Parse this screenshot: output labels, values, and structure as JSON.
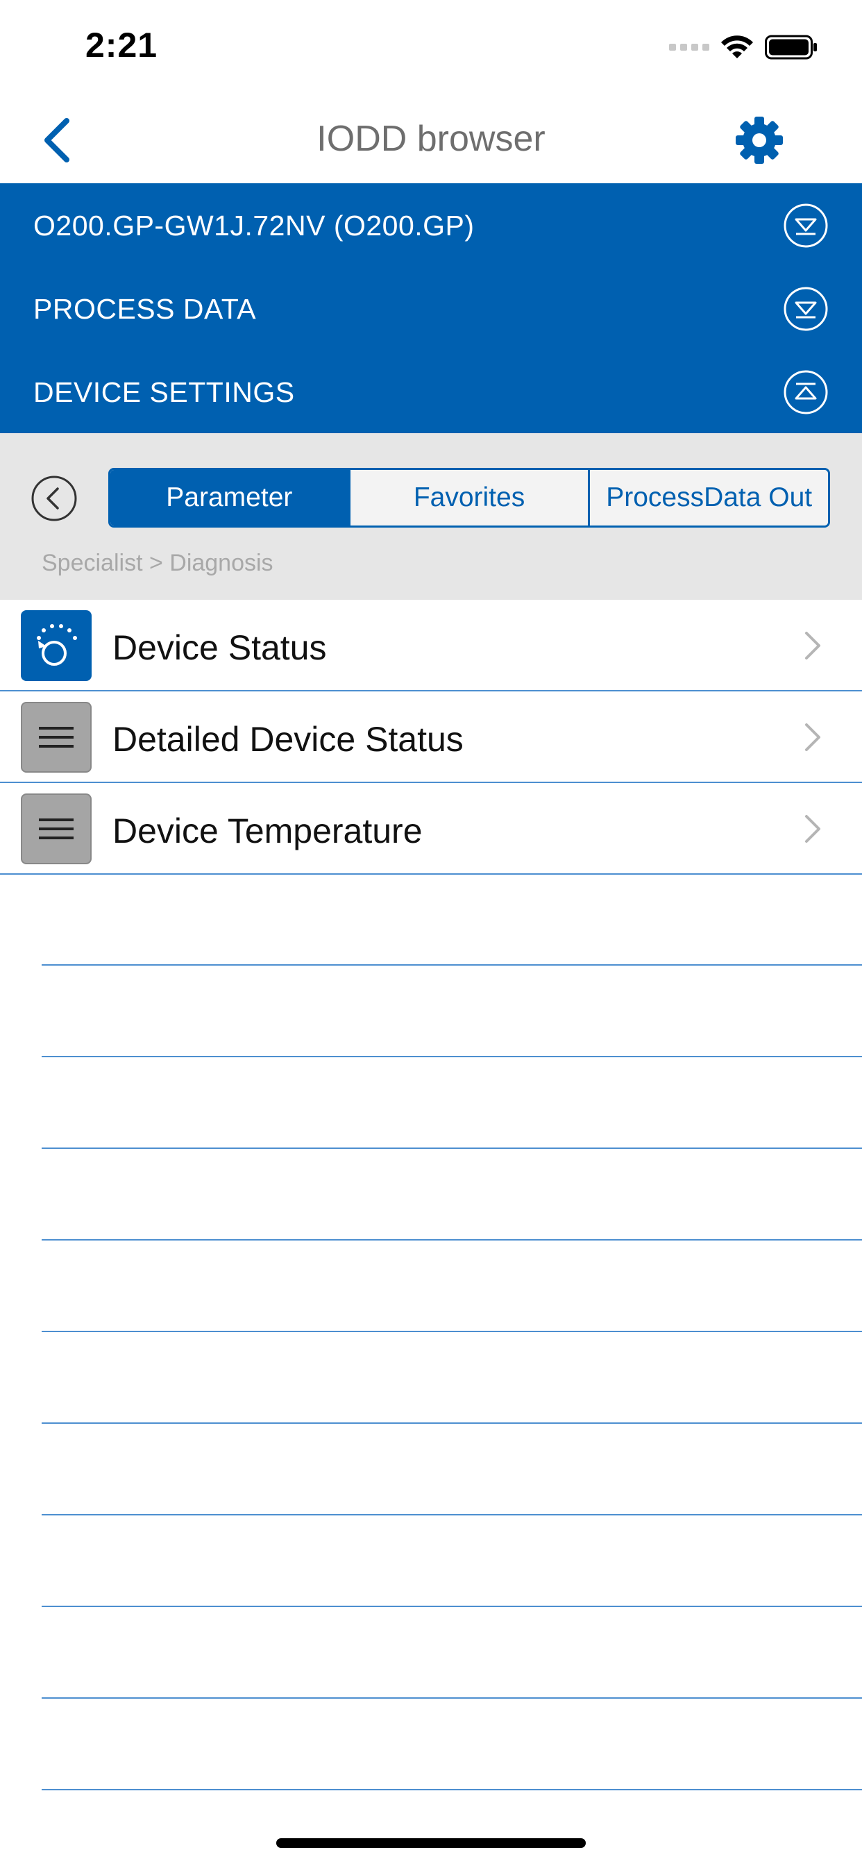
{
  "status_bar": {
    "time": "2:21"
  },
  "nav": {
    "title": "IODD browser"
  },
  "accordion": [
    {
      "label": "O200.GP-GW1J.72NV (O200.GP)",
      "state": "collapsed"
    },
    {
      "label": "PROCESS DATA",
      "state": "collapsed"
    },
    {
      "label": "DEVICE SETTINGS",
      "state": "expanded"
    }
  ],
  "tabs": [
    {
      "label": "Parameter",
      "active": true
    },
    {
      "label": "Favorites",
      "active": false
    },
    {
      "label": "ProcessData Out",
      "active": false
    }
  ],
  "breadcrumb": "Specialist > Diagnosis",
  "items": [
    {
      "label": "Device Status",
      "icon": "diagnosis-dial-icon"
    },
    {
      "label": "Detailed Device Status",
      "icon": "menu-list-icon"
    },
    {
      "label": "Device Temperature",
      "icon": "menu-list-icon"
    }
  ],
  "colors": {
    "accent": "#0060b0",
    "divider": "#4d8fd0",
    "control_bg": "#e6e6e6"
  }
}
